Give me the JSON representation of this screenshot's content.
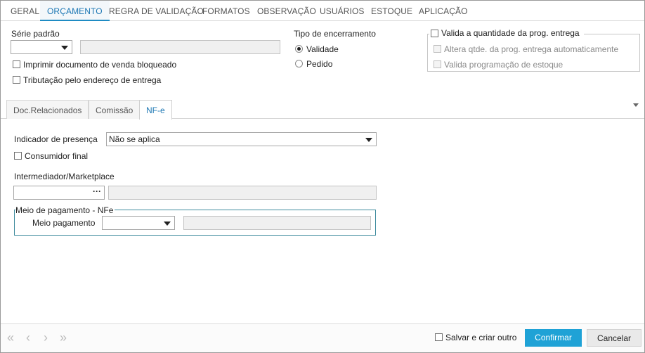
{
  "top_tabs": [
    "GERAL",
    "ORÇAMENTO",
    "REGRA DE VALIDAÇÃO",
    "FORMATOS",
    "OBSERVAÇÃO",
    "USUÁRIOS",
    "ESTOQUE",
    "APLICAÇÃO"
  ],
  "active_top_tab": "ORÇAMENTO",
  "serie": {
    "label": "Série padrão",
    "value": ""
  },
  "checks_left": {
    "imprimir": "Imprimir documento de venda bloqueado",
    "tributacao": "Tributação pelo endereço de entrega"
  },
  "tipo_encerramento": {
    "label": "Tipo de encerramento",
    "options": [
      "Validade",
      "Pedido"
    ],
    "selected": "Validade"
  },
  "valida_group": {
    "title": "Valida a quantidade da prog. entrega",
    "altera": "Altera qtde. da prog. entrega automaticamente",
    "valida_prog": "Valida programação de estoque"
  },
  "inner_tabs": [
    "Doc.Relacionados",
    "Comissão",
    "NF-e"
  ],
  "active_inner_tab": "NF-e",
  "nfe": {
    "indicador_label": "Indicador de presença",
    "indicador_value": "Não se aplica",
    "consumidor_label": "Consumidor final",
    "intermediador_label": "Intermediador/Marketplace",
    "ellipsis": "···",
    "meio_group_title": "Meio de pagamento - NFe",
    "meio_label": "Meio pagamento",
    "meio_value": ""
  },
  "footer": {
    "salvar_label": "Salvar e criar outro",
    "confirmar_label": "Confirmar",
    "cancelar_label": "Cancelar",
    "nav": [
      "«",
      "‹",
      "›",
      "»"
    ]
  },
  "colors": {
    "accent": "#1e78b4",
    "primary_button": "#1fa2d6",
    "group_teal": "#3d8a9c"
  }
}
